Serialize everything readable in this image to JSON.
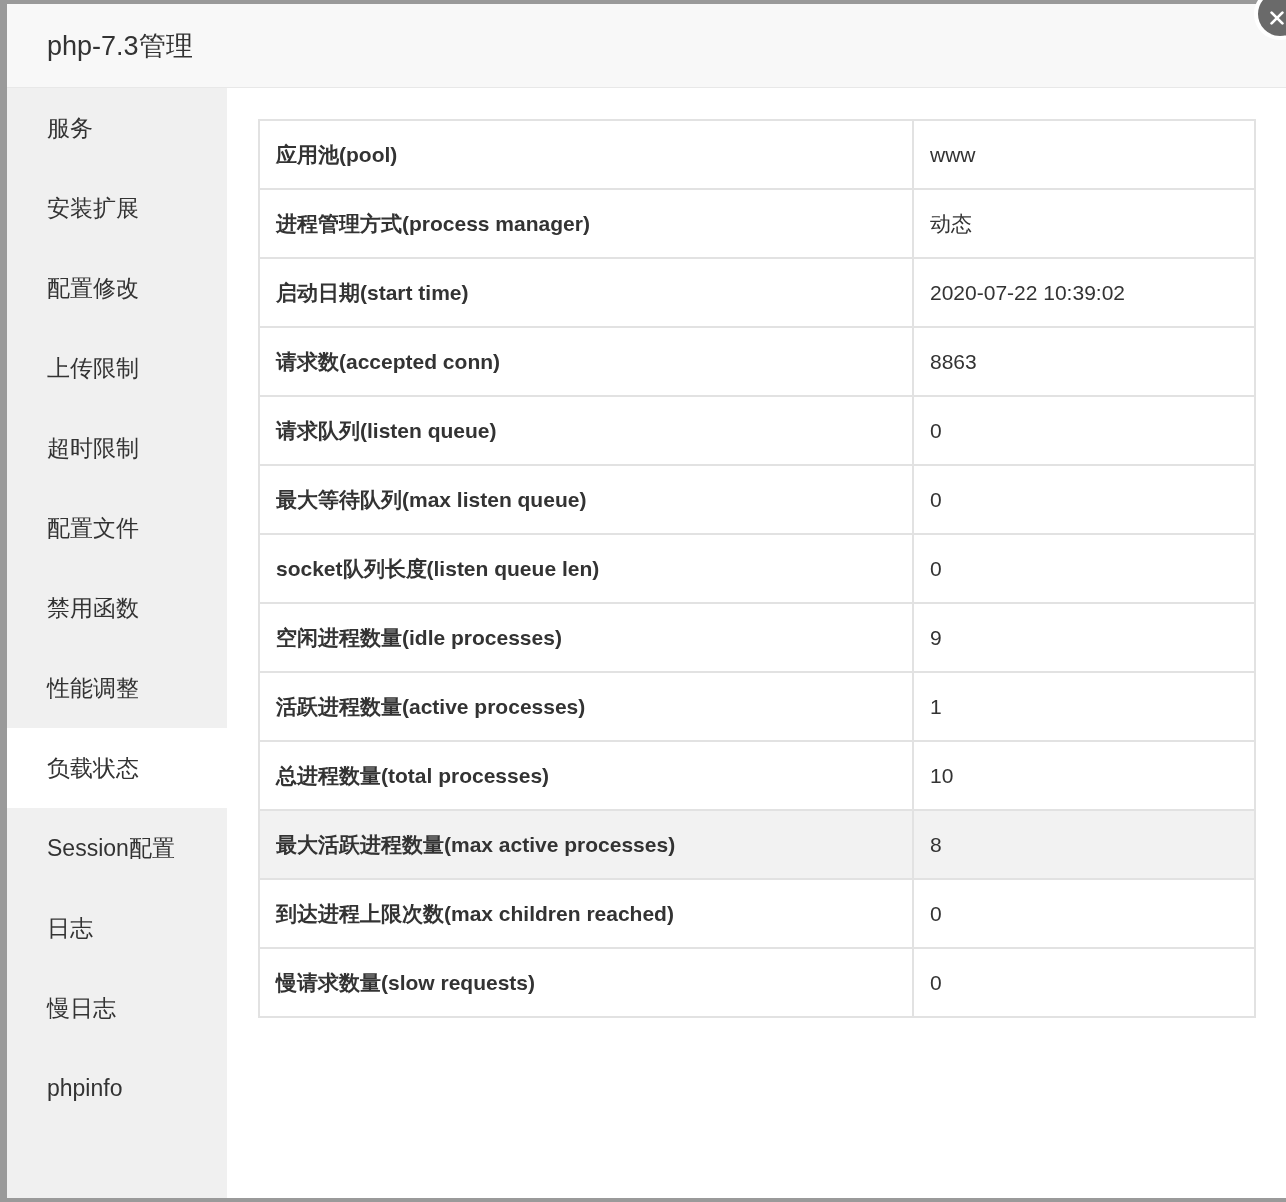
{
  "window": {
    "title": "php-7.3管理"
  },
  "sidebar": {
    "items": [
      {
        "label": "服务",
        "selected": false
      },
      {
        "label": "安装扩展",
        "selected": false
      },
      {
        "label": "配置修改",
        "selected": false
      },
      {
        "label": "上传限制",
        "selected": false
      },
      {
        "label": "超时限制",
        "selected": false
      },
      {
        "label": "配置文件",
        "selected": false
      },
      {
        "label": "禁用函数",
        "selected": false
      },
      {
        "label": "性能调整",
        "selected": false
      },
      {
        "label": "负载状态",
        "selected": true
      },
      {
        "label": "Session配置",
        "selected": false
      },
      {
        "label": "日志",
        "selected": false
      },
      {
        "label": "慢日志",
        "selected": false
      },
      {
        "label": "phpinfo",
        "selected": false
      }
    ]
  },
  "table": {
    "rows": [
      {
        "label": "应用池(pool)",
        "value": "www",
        "highlighted": false
      },
      {
        "label": "进程管理方式(process manager)",
        "value": "动态",
        "highlighted": false
      },
      {
        "label": "启动日期(start time)",
        "value": "2020-07-22 10:39:02",
        "highlighted": false
      },
      {
        "label": "请求数(accepted conn)",
        "value": "8863",
        "highlighted": false
      },
      {
        "label": "请求队列(listen queue)",
        "value": "0",
        "highlighted": false
      },
      {
        "label": "最大等待队列(max listen queue)",
        "value": "0",
        "highlighted": false
      },
      {
        "label": "socket队列长度(listen queue len)",
        "value": "0",
        "highlighted": false
      },
      {
        "label": "空闲进程数量(idle processes)",
        "value": "9",
        "highlighted": false
      },
      {
        "label": "活跃进程数量(active processes)",
        "value": "1",
        "highlighted": false
      },
      {
        "label": "总进程数量(total processes)",
        "value": "10",
        "highlighted": false
      },
      {
        "label": "最大活跃进程数量(max active processes)",
        "value": "8",
        "highlighted": true
      },
      {
        "label": "到达进程上限次数(max children reached)",
        "value": "0",
        "highlighted": false
      },
      {
        "label": "慢请求数量(slow requests)",
        "value": "0",
        "highlighted": false
      }
    ]
  }
}
